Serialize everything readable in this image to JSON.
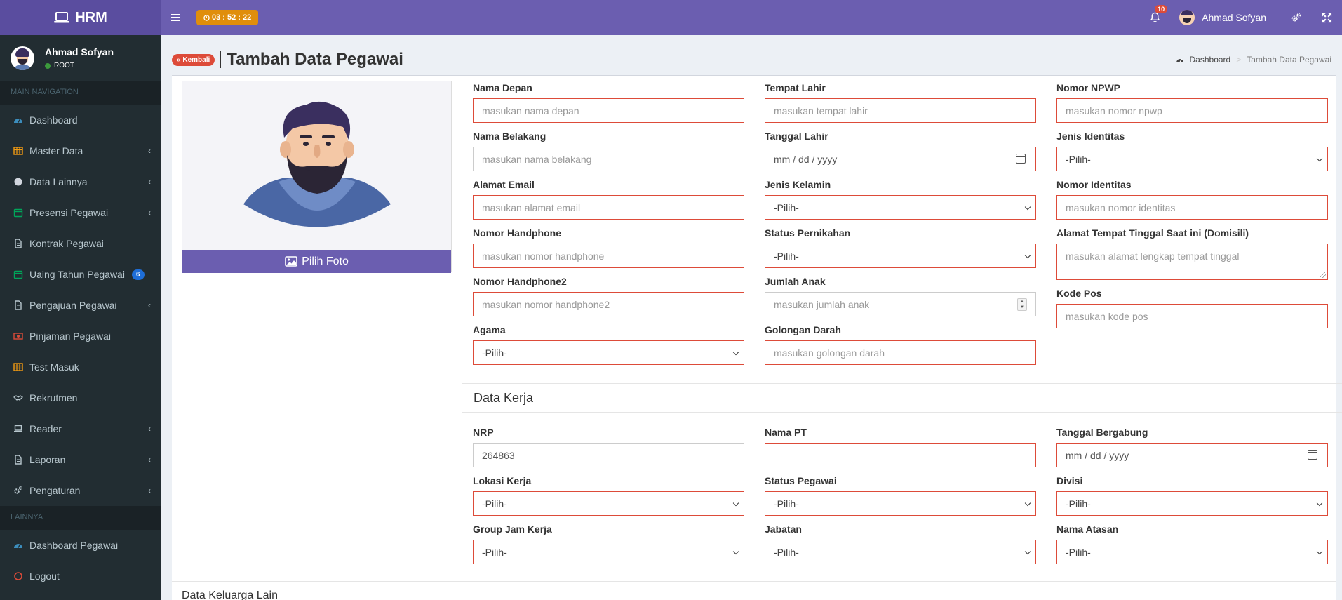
{
  "brand": {
    "name": "HRM"
  },
  "header": {
    "timer": "03 : 52 : 22",
    "notifications_count": "10",
    "user_name": "Ahmad Sofyan"
  },
  "sidebar": {
    "user_name": "Ahmad Sofyan",
    "user_role": "ROOT",
    "main_header": "MAIN NAVIGATION",
    "items": [
      {
        "label": "Dashboard",
        "icon": "dashboard-icon",
        "arrow": false
      },
      {
        "label": "Master Data",
        "icon": "table-icon",
        "arrow": true
      },
      {
        "label": "Data Lainnya",
        "icon": "circle-icon",
        "arrow": true
      },
      {
        "label": "Presensi Pegawai",
        "icon": "calendar-icon",
        "arrow": true
      },
      {
        "label": "Kontrak Pegawai",
        "icon": "file-icon",
        "arrow": false
      },
      {
        "label": "Uaing Tahun Pegawai",
        "icon": "calendar-icon",
        "arrow": false,
        "count": "6"
      },
      {
        "label": "Pengajuan Pegawai",
        "icon": "file-icon",
        "arrow": true
      },
      {
        "label": "Pinjaman Pegawai",
        "icon": "money-icon",
        "arrow": false
      },
      {
        "label": "Test Masuk",
        "icon": "table-icon",
        "arrow": false
      },
      {
        "label": "Rekrutmen",
        "icon": "handshake-icon",
        "arrow": false
      },
      {
        "label": "Reader",
        "icon": "laptop-icon",
        "arrow": true
      },
      {
        "label": "Laporan",
        "icon": "file-icon",
        "arrow": true
      },
      {
        "label": "Pengaturan",
        "icon": "cogs-icon",
        "arrow": true
      }
    ],
    "other_header": "LAINNYA",
    "other_items": [
      {
        "label": "Dashboard Pegawai",
        "icon": "dashboard-icon"
      },
      {
        "label": "Logout",
        "icon": "power-icon"
      }
    ]
  },
  "page": {
    "back_label": "Kembali",
    "title": "Tambah Data Pegawai",
    "breadcrumb_home": "Dashboard",
    "breadcrumb_current": "Tambah Data Pegawai",
    "photo_button": "Pilih Foto"
  },
  "form": {
    "nama_depan": {
      "label": "Nama Depan",
      "placeholder": "masukan nama depan"
    },
    "nama_belakang": {
      "label": "Nama Belakang",
      "placeholder": "masukan nama belakang"
    },
    "alamat_email": {
      "label": "Alamat Email",
      "placeholder": "masukan alamat email"
    },
    "nomor_handphone": {
      "label": "Nomor Handphone",
      "placeholder": "masukan nomor handphone"
    },
    "nomor_handphone2": {
      "label": "Nomor Handphone2",
      "placeholder": "masukan nomor handphone2"
    },
    "agama": {
      "label": "Agama",
      "value": "-Pilih-"
    },
    "tempat_lahir": {
      "label": "Tempat Lahir",
      "placeholder": "masukan tempat lahir"
    },
    "tanggal_lahir": {
      "label": "Tanggal Lahir",
      "value": "mm / dd / yyyy"
    },
    "jenis_kelamin": {
      "label": "Jenis Kelamin",
      "value": "-Pilih-"
    },
    "status_pernikahan": {
      "label": "Status Pernikahan",
      "value": "-Pilih-"
    },
    "jumlah_anak": {
      "label": "Jumlah Anak",
      "placeholder": "masukan jumlah anak"
    },
    "golongan_darah": {
      "label": "Golongan Darah",
      "placeholder": "masukan golongan darah"
    },
    "nomor_npwp": {
      "label": "Nomor NPWP",
      "placeholder": "masukan nomor npwp"
    },
    "jenis_identitas": {
      "label": "Jenis Identitas",
      "value": "-Pilih-"
    },
    "nomor_identitas": {
      "label": "Nomor Identitas",
      "placeholder": "masukan nomor identitas"
    },
    "alamat_domisili": {
      "label": "Alamat Tempat Tinggal Saat ini (Domisili)",
      "placeholder": "masukan alamat lengkap tempat tinggal"
    },
    "kode_pos": {
      "label": "Kode Pos",
      "placeholder": "masukan kode pos"
    }
  },
  "data_kerja": {
    "title": "Data Kerja",
    "nrp": {
      "label": "NRP",
      "value": "264863"
    },
    "nama_pt": {
      "label": "Nama PT",
      "value": ""
    },
    "tanggal_bergabung": {
      "label": "Tanggal Bergabung",
      "value": "mm / dd / yyyy"
    },
    "lokasi_kerja": {
      "label": "Lokasi Kerja",
      "value": "-Pilih-"
    },
    "status_pegawai": {
      "label": "Status Pegawai",
      "value": "-Pilih-"
    },
    "divisi": {
      "label": "Divisi",
      "value": "-Pilih-"
    },
    "group_jam_kerja": {
      "label": "Group Jam Kerja",
      "value": "-Pilih-"
    },
    "jabatan": {
      "label": "Jabatan",
      "value": "-Pilih-"
    },
    "nama_atasan": {
      "label": "Nama Atasan",
      "value": "-Pilih-"
    }
  },
  "next_section_title": "Data Keluarga Lain",
  "colors": {
    "header": "#6b5eb0",
    "logo": "#5a4d9f",
    "sidebar": "#222d32",
    "danger": "#dd4b39",
    "timer": "#e08e0b",
    "badge_blue": "#1e6ed8"
  }
}
